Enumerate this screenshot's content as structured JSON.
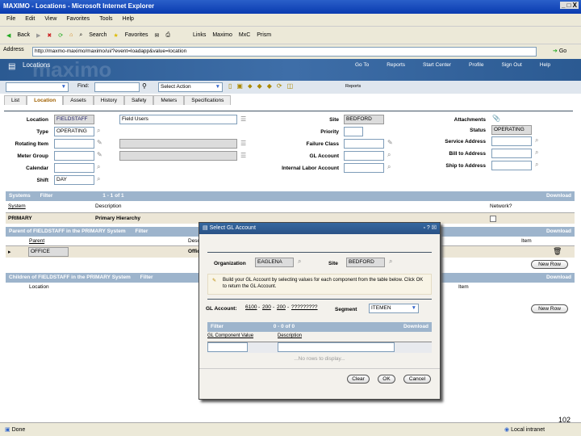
{
  "window": {
    "title": "MAXIMO - Locations - Microsoft Internet Explorer"
  },
  "menu": [
    "File",
    "Edit",
    "View",
    "Favorites",
    "Tools",
    "Help"
  ],
  "ie_toolbar": {
    "back": "Back",
    "search": "Search",
    "favorites": "Favorites",
    "links": "Links",
    "link1": "Maximo",
    "link2": "MxC",
    "link3": "Prism"
  },
  "address": {
    "label": "Address",
    "url": "http://maxmo-maximo/maximo/ui/?event=loadapp&value=location",
    "go": "Go"
  },
  "app": {
    "name": "Locations",
    "logo": "maximo",
    "nav": [
      "Go To",
      "Reports",
      "Start Center",
      "Profile",
      "Sign Out",
      "Help"
    ]
  },
  "toolbar": {
    "find_label": "Find:",
    "select_action": "Select Action",
    "reports": "Reports"
  },
  "tabs": [
    "List",
    "Location",
    "Assets",
    "History",
    "Safety",
    "Meters",
    "Specifications"
  ],
  "form": {
    "location_label": "Location",
    "location": "FIELDSTAFF",
    "description": "Field Users",
    "type_label": "Type",
    "type": "OPERATING",
    "rotating_label": "Rotating Item",
    "meter_label": "Meter Group",
    "calendar_label": "Calendar",
    "shift_label": "Shift",
    "shift": "DAY",
    "site_label": "Site",
    "site": "BEDFORD",
    "priority_label": "Priority",
    "failure_label": "Failure Class",
    "gl_label": "GL Account",
    "ila_label": "Internal Labor Account",
    "attach_label": "Attachments",
    "status_label": "Status",
    "status": "OPERATING",
    "service_label": "Service Address",
    "bill_label": "Bill to Address",
    "ship_label": "Ship to Address"
  },
  "systems": {
    "title": "Systems",
    "filter": "Filter",
    "paging": "1 - 1 of 1",
    "download": "Download",
    "cols": [
      "System",
      "Description",
      "Network?"
    ],
    "row": [
      "PRIMARY",
      "Primary Hierarchy"
    ]
  },
  "parent": {
    "title": "Parent of FIELDSTAFF in the PRIMARY System",
    "filter": "Filter",
    "download": "Download",
    "cols": [
      "Parent",
      "Description",
      "Item"
    ],
    "row": [
      "OFFICE",
      "Office"
    ],
    "new_row": "New Row"
  },
  "children": {
    "title": "Children of FIELDSTAFF in the PRIMARY System",
    "filter": "Filter",
    "download": "Download",
    "cols": [
      "Location",
      "Item"
    ],
    "new_row": "New Row"
  },
  "dialog": {
    "title": "Select GL Account",
    "org_label": "Organization",
    "org": "EAGLENA",
    "site_label": "Site",
    "site": "BEDFORD",
    "info": "Build your GL Account by selecting values for each component from the table below. Click OK to return the GL Account.",
    "gl_label": "GL Account:",
    "gl_parts": [
      "6100",
      "200",
      "200",
      "?????????"
    ],
    "segment_label": "Segment",
    "segment": "ITEMEN",
    "filter": "Filter",
    "paging": "0 - 0 of 0",
    "download": "Download",
    "cols": [
      "GL Component Value",
      "Description"
    ],
    "empty": "...No rows to display...",
    "clear": "Clear",
    "ok": "OK",
    "cancel": "Cancel"
  },
  "page_number": "102",
  "statusbar": {
    "text": "Done",
    "zone": "Local intranet"
  }
}
